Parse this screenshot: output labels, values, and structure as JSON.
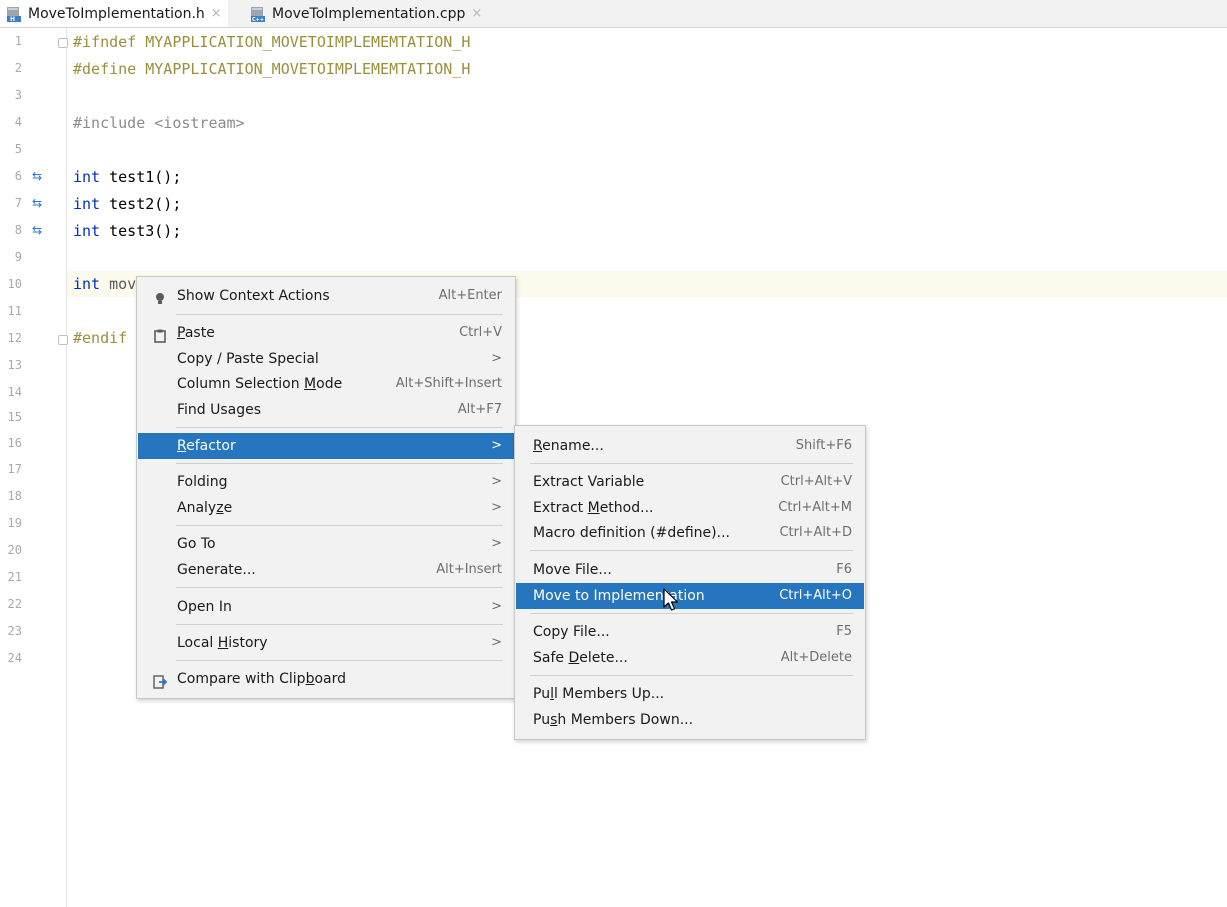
{
  "tabs": [
    {
      "label": "MoveToImplementation.h",
      "close": "×",
      "active": true
    },
    {
      "label": "MoveToImplementation.cpp",
      "close": "×",
      "active": false
    }
  ],
  "gutter": {
    "line_numbers": [
      "1",
      "2",
      "3",
      "4",
      "5",
      "6",
      "7",
      "8",
      "9",
      "10",
      "11",
      "12",
      "13",
      "14",
      "15",
      "16",
      "17",
      "18",
      "19",
      "20",
      "21",
      "22",
      "23",
      "24"
    ]
  },
  "code": {
    "line1": "#ifndef MYAPPLICATION_MOVETOIMPLEMEMTATION_H",
    "line2": "#define MYAPPLICATION_MOVETOIMPLEMEMTATION_H",
    "line4": "#include <iostream>",
    "line6_kw": "int",
    "line6_rest": " test1();",
    "line7_kw": "int",
    "line7_rest": " test2();",
    "line8_kw": "int",
    "line8_rest": " test3();",
    "line10_kw": "int",
    "line10_rest": " mov",
    "line12": "#endif"
  },
  "context_menu": {
    "items": {
      "show_context_actions": {
        "label": "Show Context Actions",
        "shortcut": "Alt+Enter"
      },
      "paste": {
        "label_pre": "",
        "label_u": "P",
        "label_post": "aste",
        "shortcut": "Ctrl+V"
      },
      "copy_paste_special": {
        "label": "Copy / Paste Special",
        "arrow": ">"
      },
      "column_selection": {
        "label_pre": "Column Selection ",
        "label_u": "M",
        "label_post": "ode",
        "shortcut": "Alt+Shift+Insert"
      },
      "find_usages": {
        "label": "Find Usages",
        "shortcut": "Alt+F7"
      },
      "refactor": {
        "label_pre": "",
        "label_u": "R",
        "label_post": "efactor",
        "arrow": ">"
      },
      "folding": {
        "label": "Folding",
        "arrow": ">"
      },
      "analyze": {
        "label_pre": "Analy",
        "label_u": "z",
        "label_post": "e",
        "arrow": ">"
      },
      "go_to": {
        "label": "Go To",
        "arrow": ">"
      },
      "generate": {
        "label": "Generate...",
        "shortcut": "Alt+Insert"
      },
      "open_in": {
        "label": "Open In",
        "arrow": ">"
      },
      "local_history": {
        "label_pre": "Local ",
        "label_u": "H",
        "label_post": "istory",
        "arrow": ">"
      },
      "compare_clipboard": {
        "label_pre": "Compare with Clip",
        "label_u": "b",
        "label_post": "oard"
      }
    }
  },
  "refactor_menu": {
    "items": {
      "rename": {
        "label_pre": "",
        "label_u": "R",
        "label_post": "ename...",
        "shortcut": "Shift+F6"
      },
      "extract_variable": {
        "label": "Extract Variable",
        "shortcut": "Ctrl+Alt+V"
      },
      "extract_method": {
        "label_pre": "Extract ",
        "label_u": "M",
        "label_post": "ethod...",
        "shortcut": "Ctrl+Alt+M"
      },
      "macro_definition": {
        "label": "Macro definition (#define)...",
        "shortcut": "Ctrl+Alt+D"
      },
      "move_file": {
        "label": "Move File...",
        "shortcut": "F6"
      },
      "move_to_impl": {
        "label": "Move to Implementation",
        "shortcut": "Ctrl+Alt+O"
      },
      "copy_file": {
        "label": "Copy File...",
        "shortcut": "F5"
      },
      "safe_delete": {
        "label_pre": "Safe ",
        "label_u": "D",
        "label_post": "elete...",
        "shortcut": "Alt+Delete"
      },
      "pull_members_up": {
        "label_pre": "Pu",
        "label_u": "l",
        "label_post": "l Members Up..."
      },
      "push_members_down": {
        "label_pre": "Pu",
        "label_u": "s",
        "label_post": "h Members Down..."
      }
    }
  },
  "colors": {
    "selection": "#2675bf",
    "preprocessor": "#9b8f3b",
    "keyword": "#0033b3",
    "menu_bg": "#f2f2f2"
  }
}
